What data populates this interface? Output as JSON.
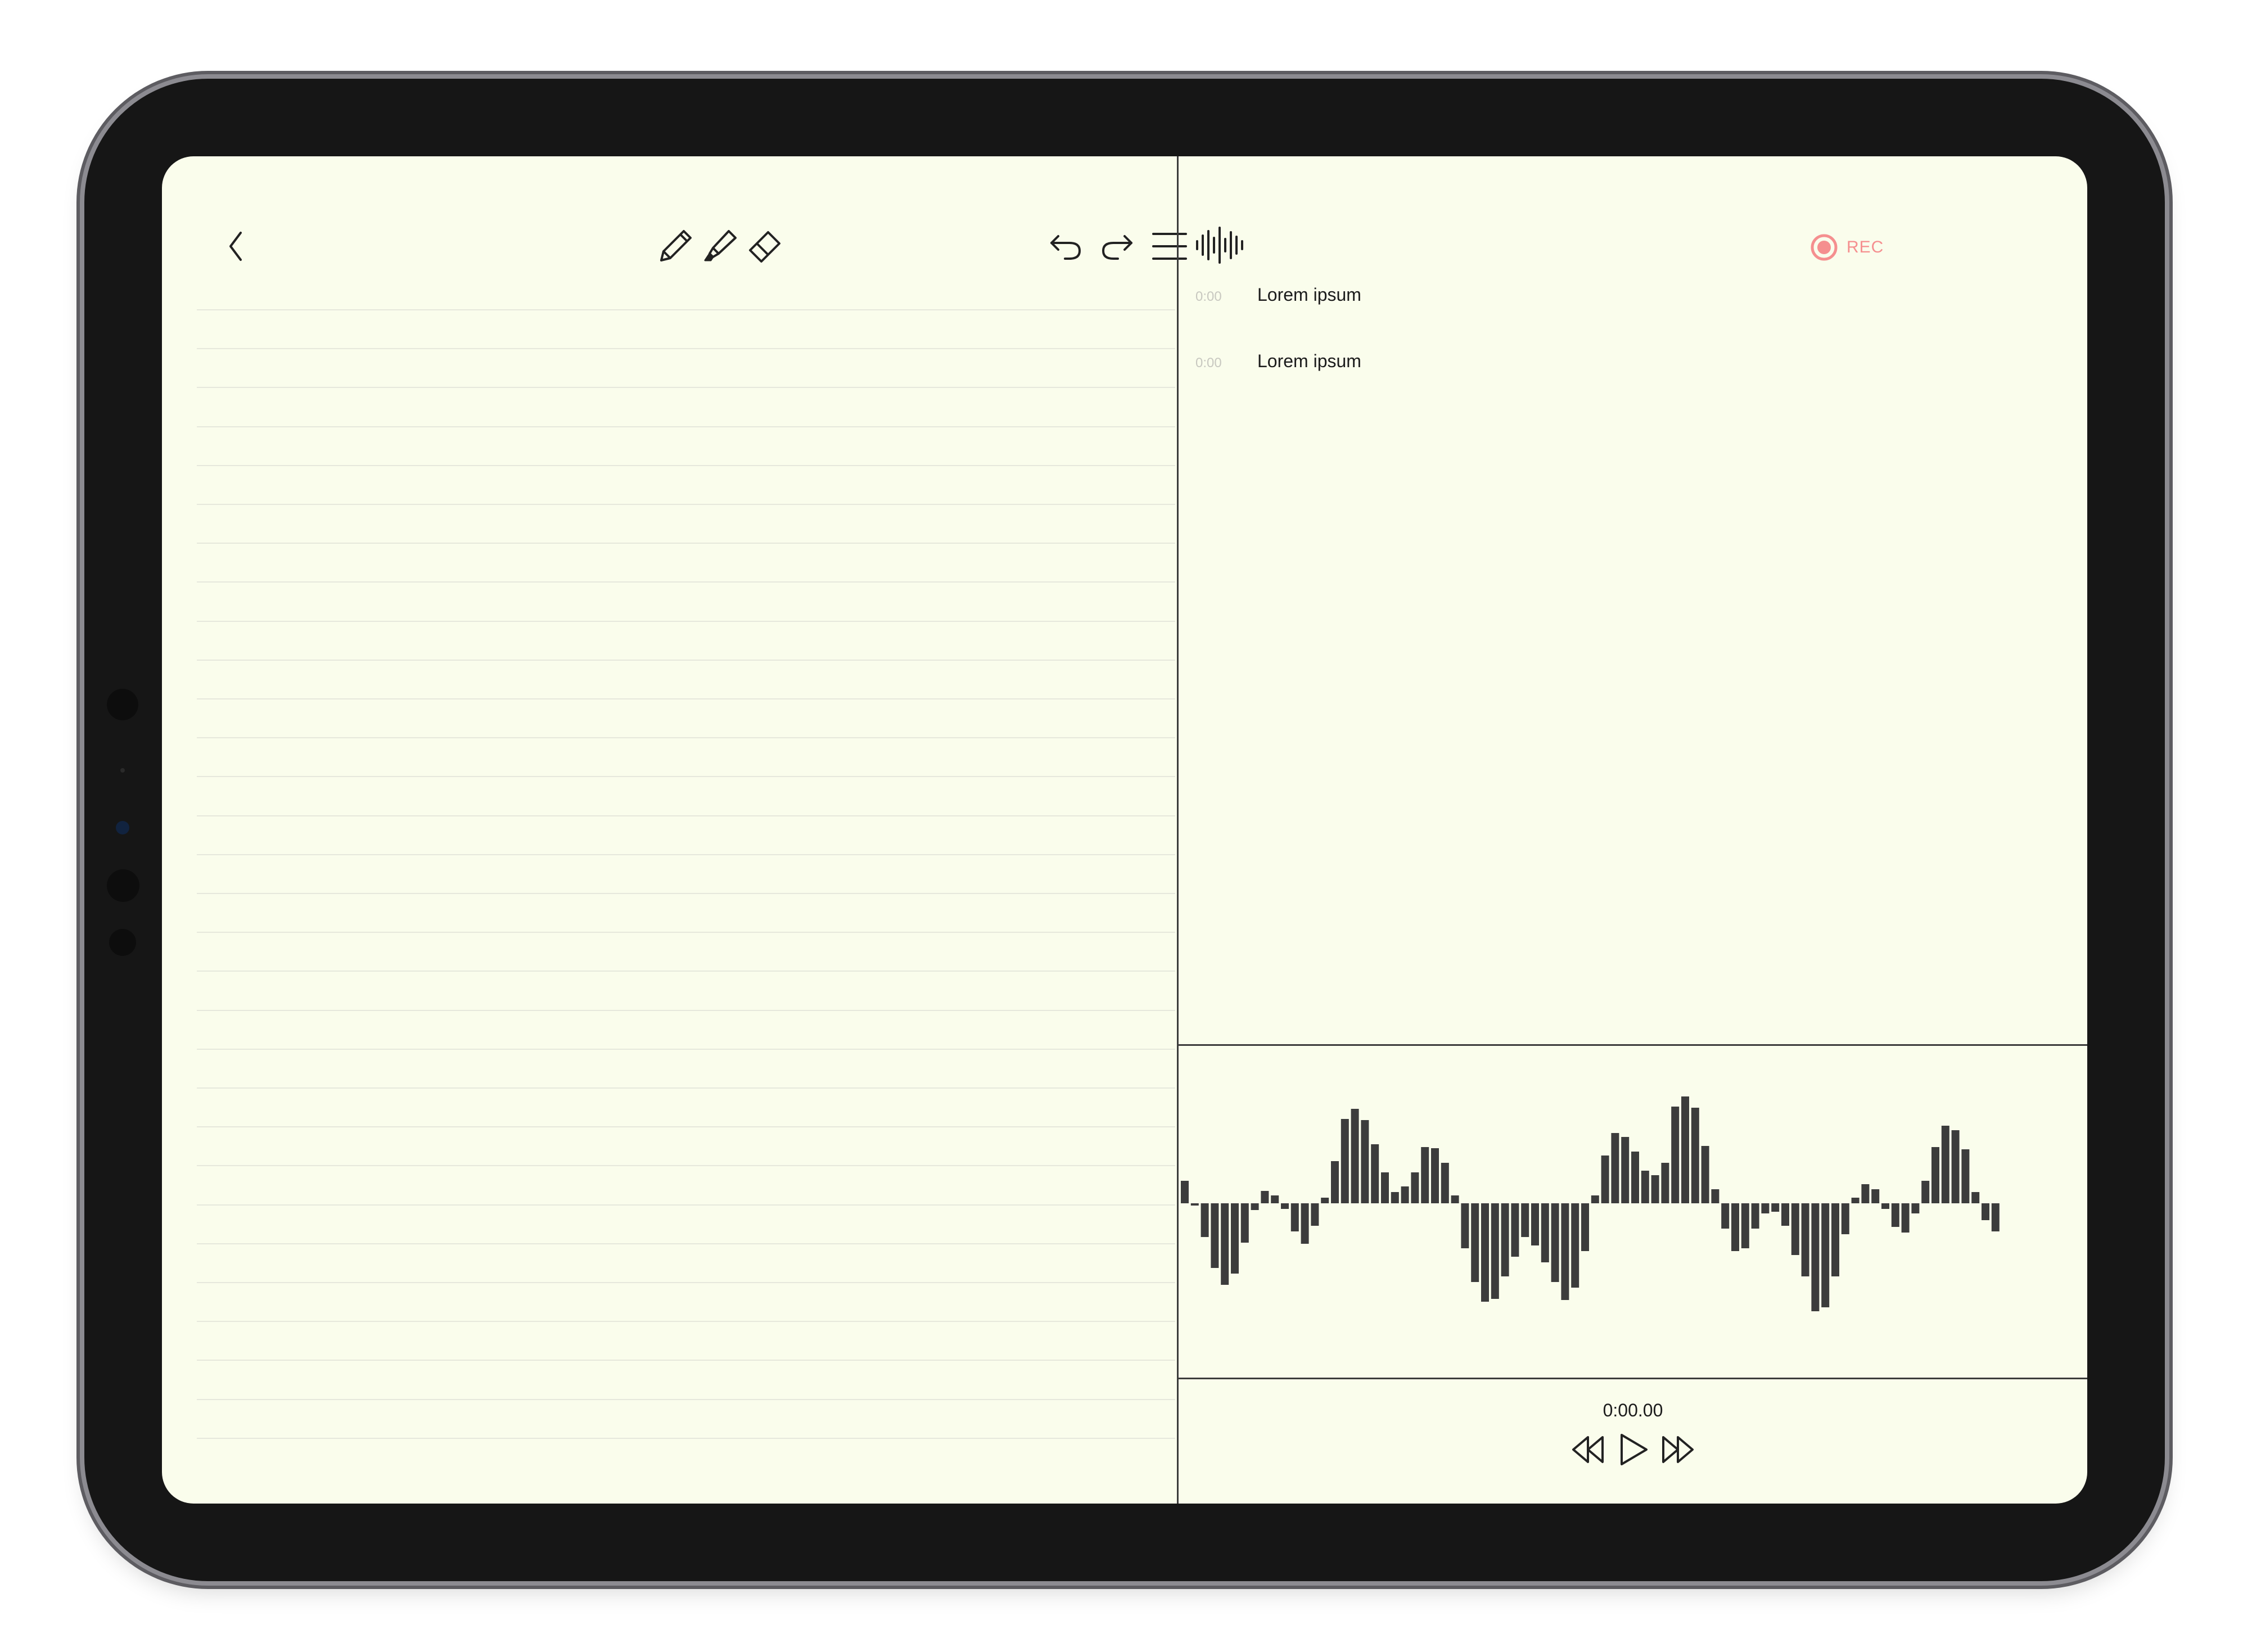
{
  "toolbar": {
    "icons": [
      "chevron-left-icon",
      "pencil-icon",
      "highlighter-icon",
      "eraser-icon",
      "undo-icon",
      "redo-icon",
      "menu-icon"
    ]
  },
  "audio": {
    "rec_label": "REC",
    "rec_color": "#f58f8f",
    "transcript": [
      {
        "time": "0:00",
        "text": "Lorem ipsum"
      },
      {
        "time": "0:00",
        "text": "Lorem ipsum"
      }
    ],
    "playback_time": "0:00.00",
    "waveform_levels": [
      0.4,
      -0.02,
      -0.6,
      -1.15,
      -1.45,
      -1.25,
      -0.7,
      -0.12,
      0.22,
      0.14,
      -0.1,
      -0.5,
      -0.72,
      -0.4,
      0.1,
      0.75,
      1.5,
      1.68,
      1.48,
      1.05,
      0.55,
      0.2,
      0.3,
      0.55,
      1.0,
      0.98,
      0.72,
      0.14,
      -0.8,
      -1.4,
      -1.75,
      -1.7,
      -1.3,
      -0.95,
      -0.6,
      -0.75,
      -1.05,
      -1.4,
      -1.72,
      -1.5,
      -0.85,
      0.14,
      0.85,
      1.25,
      1.18,
      0.92,
      0.58,
      0.5,
      0.72,
      1.72,
      1.9,
      1.7,
      1.02,
      0.25,
      -0.45,
      -0.85,
      -0.8,
      -0.45,
      -0.18,
      -0.15,
      -0.4,
      -0.92,
      -1.3,
      -1.92,
      -1.85,
      -1.3,
      -0.55,
      0.1,
      0.34,
      0.25,
      -0.1,
      -0.42,
      -0.52,
      -0.18,
      0.4,
      1.0,
      1.38,
      1.3,
      0.96,
      0.2,
      -0.3,
      -0.5
    ]
  },
  "colors": {
    "paper": "#fafdec",
    "ink": "#3c3c3c",
    "ruled": "#e6e8dc",
    "bezel": "#161616"
  }
}
